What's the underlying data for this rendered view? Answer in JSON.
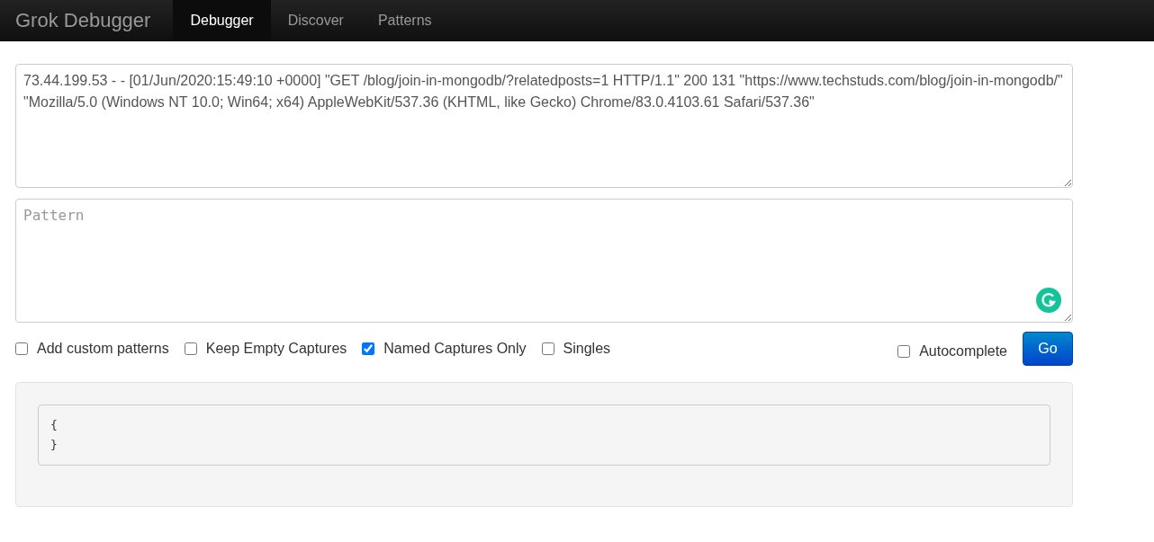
{
  "navbar": {
    "brand": "Grok Debugger",
    "tabs": [
      {
        "label": "Debugger",
        "selected": true
      },
      {
        "label": "Discover",
        "selected": false
      },
      {
        "label": "Patterns",
        "selected": false
      }
    ]
  },
  "log_input": {
    "value": "73.44.199.53 - - [01/Jun/2020:15:49:10 +0000] \"GET /blog/join-in-mongodb/?relatedposts=1 HTTP/1.1\" 200 131 \"https://www.techstuds.com/blog/join-in-mongodb/\" \"Mozilla/5.0 (Windows NT 10.0; Win64; x64) AppleWebKit/537.36 (KHTML, like Gecko) Chrome/83.0.4103.61 Safari/537.36\""
  },
  "pattern_input": {
    "placeholder": "Pattern"
  },
  "options": [
    {
      "label": "Add custom patterns",
      "checked": false
    },
    {
      "label": "Keep Empty Captures",
      "checked": false
    },
    {
      "label": "Named Captures Only",
      "checked": true
    },
    {
      "label": "Singles",
      "checked": false
    }
  ],
  "autocomplete": {
    "label": "Autocomplete",
    "checked": false
  },
  "go_button": "Go",
  "output": [
    "{",
    "}"
  ]
}
